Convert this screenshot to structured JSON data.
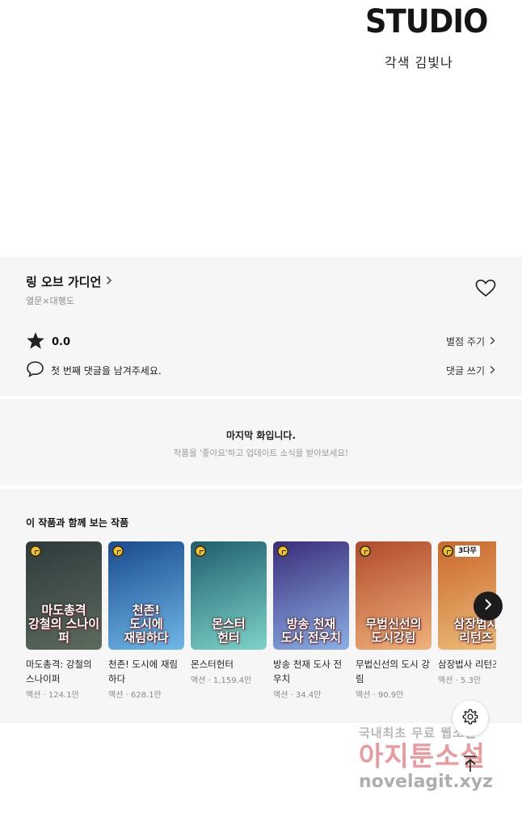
{
  "banner": {
    "studio_logo": "STUDIO",
    "studio_credit": "각색 김빛나"
  },
  "work": {
    "title": "링 오브 가디언",
    "authors": "열문×대행도",
    "rating": "0.0",
    "comment_prompt": "첫 번째 댓글을 남겨주세요.",
    "rate_link": "별점 주기",
    "comment_link": "댓글 쓰기"
  },
  "last_episode": {
    "title": "마지막 화입니다.",
    "subtitle": "작품을 '좋아요'하고 업데이트 소식을 받아보세요!"
  },
  "related": {
    "heading": "이 작품과 함께 보는 작품",
    "items": [
      {
        "title": "마도총격: 강철의 스나이퍼",
        "meta": "액션 · 124.1만",
        "cover_text": "마도총격\n강철의 스나이퍼",
        "colors": [
          "#2e3a3c",
          "#5d6a5e"
        ],
        "badge": ""
      },
      {
        "title": "천존! 도시에 재림하다",
        "meta": "액션 · 628.1만",
        "cover_text": "천존!\n도시에\n재림하다",
        "colors": [
          "#1a4a8e",
          "#6fb8e8"
        ],
        "badge": ""
      },
      {
        "title": "몬스터헌터",
        "meta": "액션 · 1,159.4만",
        "cover_text": "몬스터\n헌터",
        "colors": [
          "#1f5e6e",
          "#7dd3c8"
        ],
        "badge": ""
      },
      {
        "title": "방송 천재 도사 전우치",
        "meta": "액션 · 34.4만",
        "cover_text": "방송 천재\n도사 전우치",
        "colors": [
          "#3a2d7a",
          "#8bb0e6"
        ],
        "badge": ""
      },
      {
        "title": "무법신선의 도시 강림",
        "meta": "액션 · 90.9만",
        "cover_text": "무법신선의\n도시강림",
        "colors": [
          "#b04a2c",
          "#f0b27a"
        ],
        "badge": ""
      },
      {
        "title": "삼장법사 리턴즈",
        "meta": "액션 · 5.3만",
        "cover_text": "삼장법사\n리턴즈",
        "colors": [
          "#c9672c",
          "#eec07c"
        ],
        "badge": "3다무"
      }
    ]
  },
  "watermark": {
    "line1": "국내최초 무료 웹소설",
    "line2": "아지툰소설",
    "line3": "novelagit.xyz"
  },
  "colors": {
    "accent": "#f4c21b",
    "panel": "#f6f6f6"
  }
}
